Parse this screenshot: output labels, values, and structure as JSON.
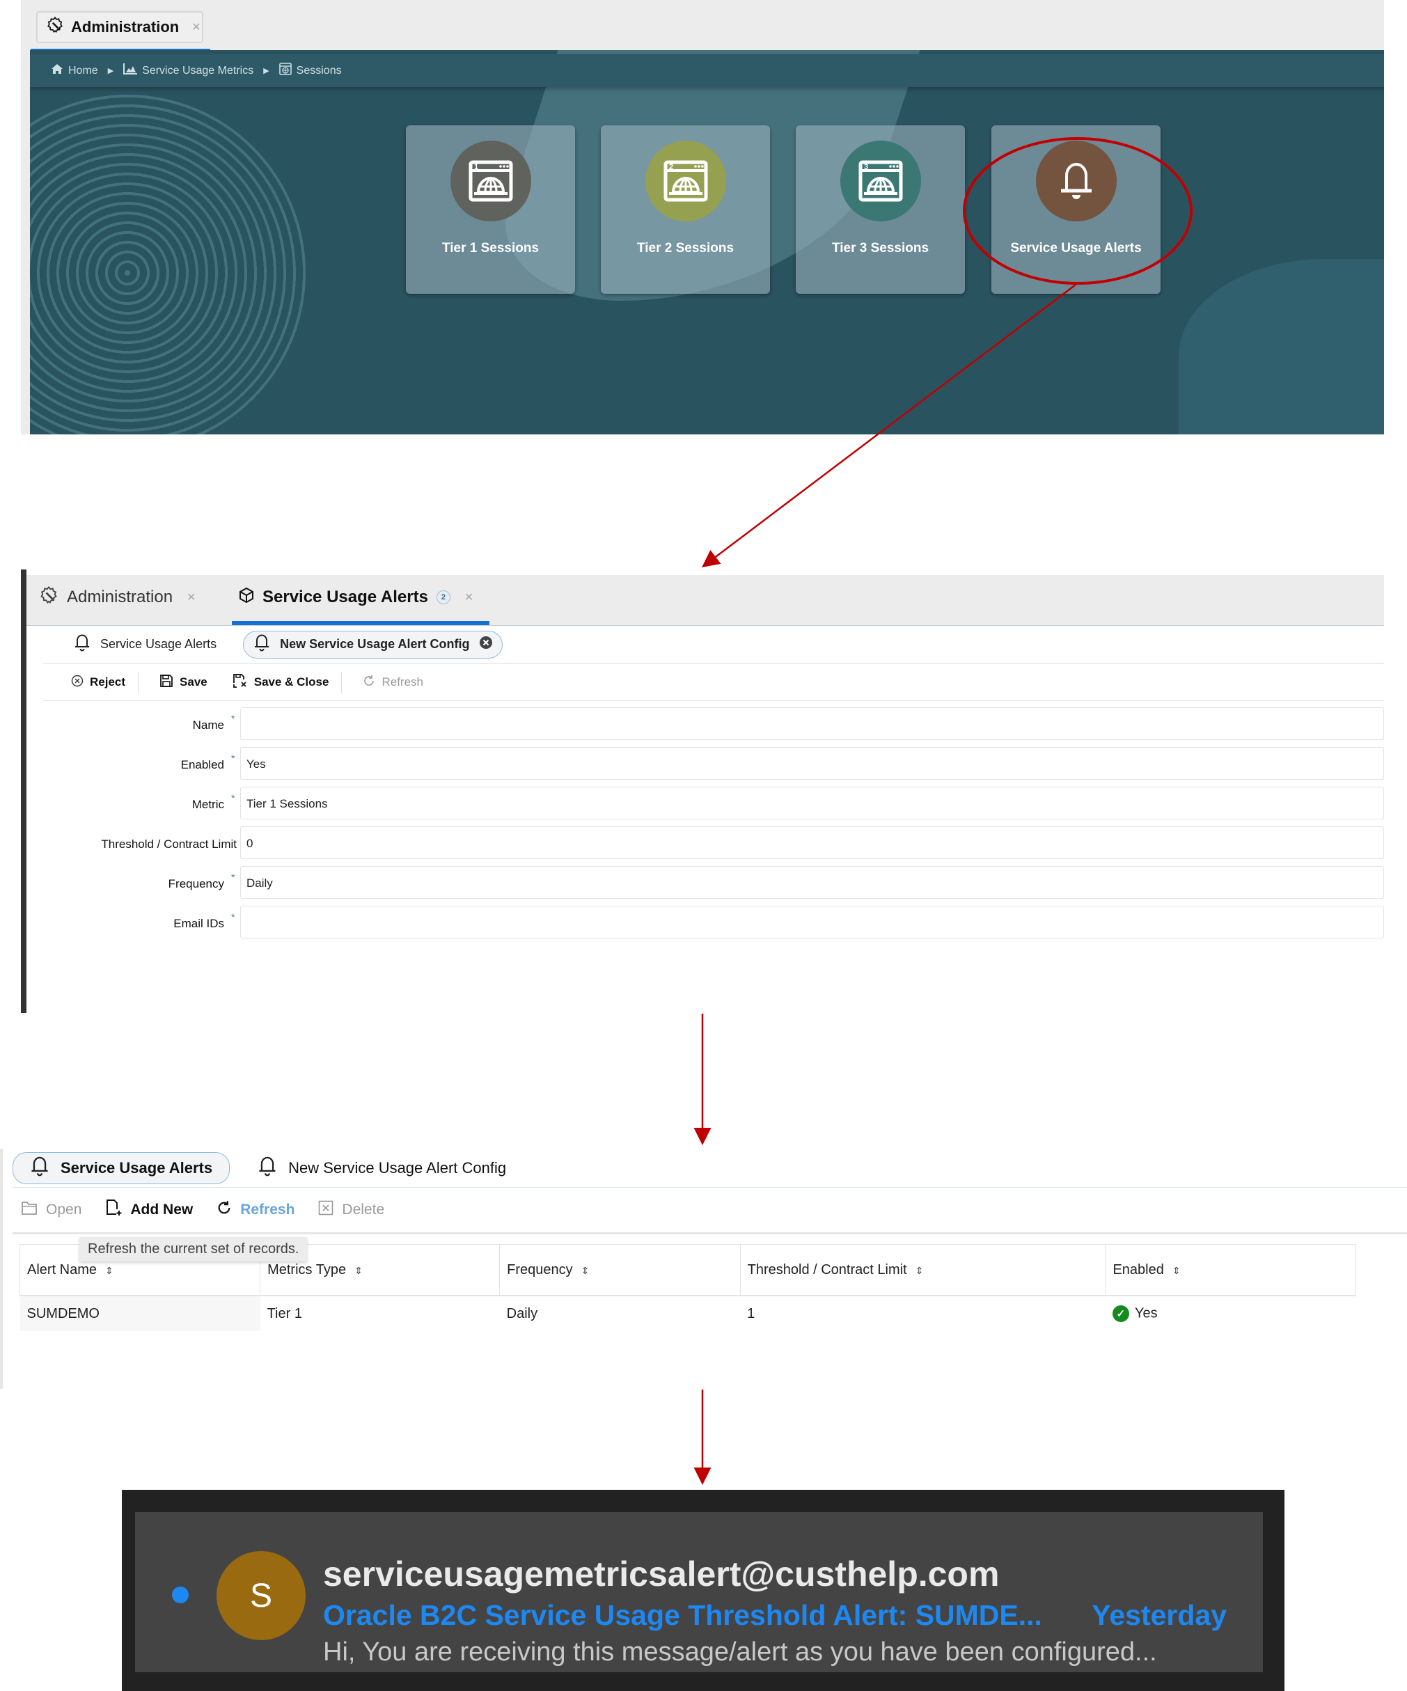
{
  "colors": {
    "accent_blue": "#1470d2",
    "annotation_red": "#c00000",
    "stage_bg": "#2a5360",
    "tier1": "#5f625d",
    "tier2": "#96a051",
    "tier3": "#3b7773",
    "alerts": "#74533f",
    "enabled_green": "#148a1f",
    "mail_blue": "#1e88f2",
    "avatar": "#9a6a10"
  },
  "step1": {
    "tab": {
      "label": "Administration",
      "icon": "admin-gear-wrench-icon"
    },
    "breadcrumb": [
      {
        "label": "Home",
        "icon": "home-icon"
      },
      {
        "label": "Service Usage Metrics",
        "icon": "chart-icon"
      },
      {
        "label": "Sessions",
        "icon": "sessions-icon"
      }
    ],
    "tiles": [
      {
        "label": "Tier 1 Sessions",
        "icon": "web-session-icon",
        "number": "1"
      },
      {
        "label": "Tier 2 Sessions",
        "icon": "web-session-icon",
        "number": "2"
      },
      {
        "label": "Tier 3 Sessions",
        "icon": "web-session-icon",
        "number": "3"
      },
      {
        "label": "Service Usage Alerts",
        "icon": "bell-icon"
      }
    ]
  },
  "step2": {
    "tabs": [
      {
        "label": "Administration",
        "icon": "admin-gear-wrench-icon"
      },
      {
        "label": "Service Usage Alerts",
        "icon": "cube-icon",
        "badge": "2"
      }
    ],
    "subtabs": [
      {
        "label": "Service Usage Alerts",
        "icon": "bell-icon"
      },
      {
        "label": "New Service Usage Alert Config",
        "icon": "bell-icon",
        "active": true
      }
    ],
    "toolbar": {
      "reject": "Reject",
      "save": "Save",
      "save_close": "Save & Close",
      "refresh": "Refresh"
    },
    "form": [
      {
        "label": "Name",
        "required": true,
        "value": ""
      },
      {
        "label": "Enabled",
        "required": true,
        "value": "Yes"
      },
      {
        "label": "Metric",
        "required": true,
        "value": "Tier 1 Sessions"
      },
      {
        "label": "Threshold / Contract Limit",
        "required": false,
        "value": "0"
      },
      {
        "label": "Frequency",
        "required": true,
        "value": "Daily"
      },
      {
        "label": "Email IDs",
        "required": true,
        "value": ""
      }
    ],
    "required_mark": "*"
  },
  "step3": {
    "subtabs": [
      {
        "label": "Service Usage Alerts",
        "icon": "bell-icon",
        "active": true
      },
      {
        "label": "New Service Usage Alert Config",
        "icon": "bell-icon"
      }
    ],
    "toolbar": {
      "open": "Open",
      "add_new": "Add New",
      "refresh": "Refresh",
      "delete": "Delete"
    },
    "tooltip": "Refresh the current set of records.",
    "columns": [
      "Alert Name",
      "Metrics Type",
      "Frequency",
      "Threshold / Contract Limit",
      "Enabled"
    ],
    "rows": [
      {
        "alert_name": "SUMDEMO",
        "metrics_type": "Tier 1",
        "frequency": "Daily",
        "threshold": "1",
        "enabled": "Yes"
      }
    ]
  },
  "step4": {
    "avatar_letter": "S",
    "from": "serviceusagemetricsalert@custhelp.com",
    "subject": "Oracle B2C Service Usage Threshold Alert: SUMDE...",
    "when": "Yesterday",
    "preview": "Hi, You are receiving this message/alert as you have been configured..."
  }
}
